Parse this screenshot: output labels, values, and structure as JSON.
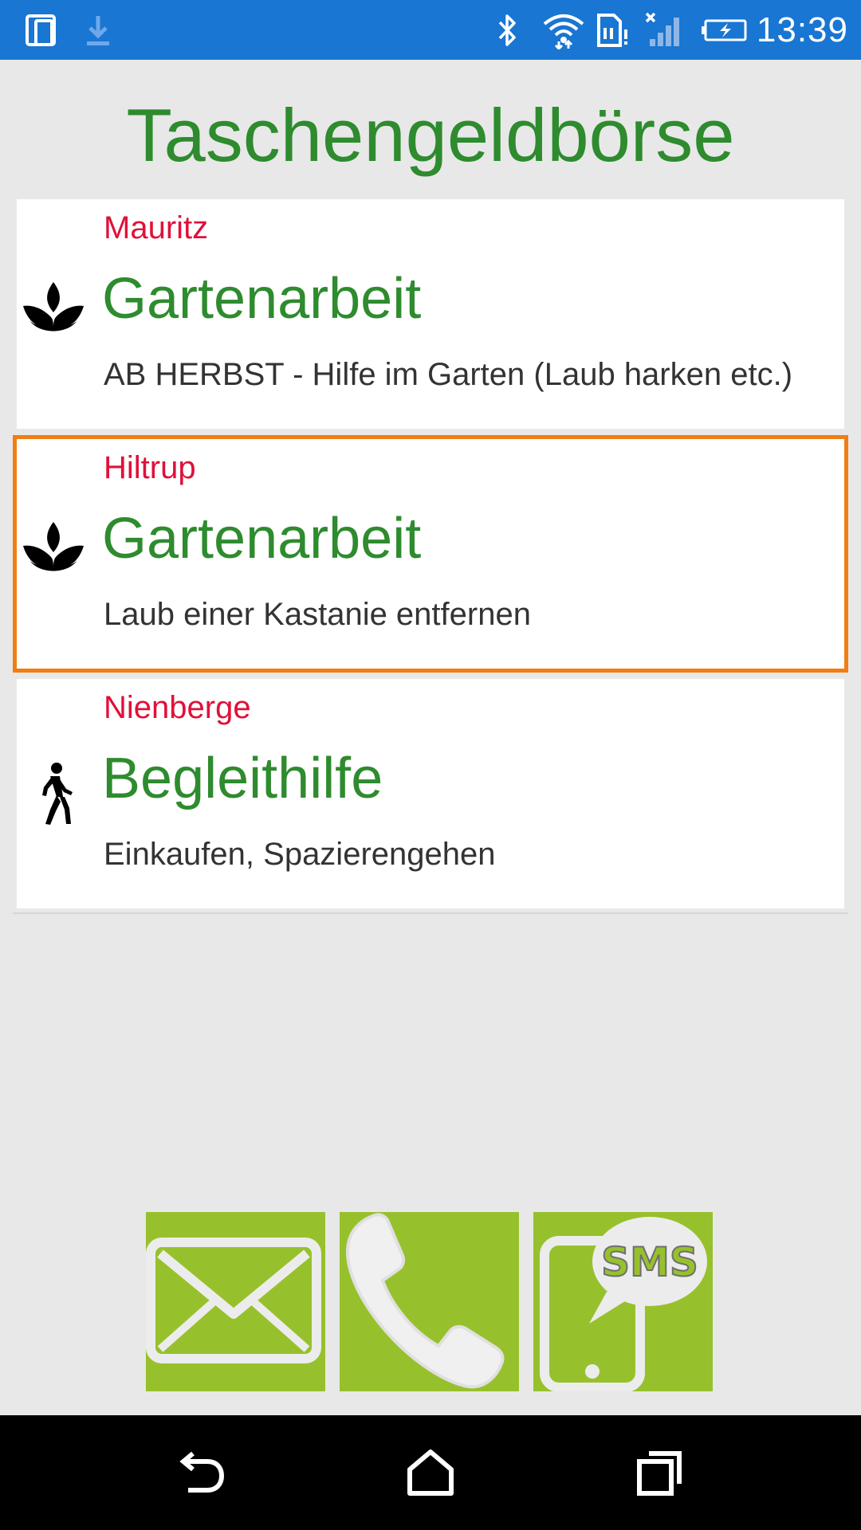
{
  "status_bar": {
    "time": "13:39",
    "icons": [
      "device-icon",
      "download-icon",
      "bluetooth-icon",
      "wifi-icon",
      "sim-icon",
      "signal-icon",
      "battery-icon"
    ],
    "color": "#1976d2"
  },
  "page": {
    "title": "Taschengeldbörse",
    "title_color": "#2e8b2e",
    "background": "#e8e8e8"
  },
  "jobs": [
    {
      "location": "Mauritz",
      "title": "Gartenarbeit",
      "description": "AB HERBST - Hilfe im Garten (Laub harken etc.)",
      "icon": "plant-icon",
      "selected": false
    },
    {
      "location": "Hiltrup",
      "title": "Gartenarbeit",
      "description": "Laub einer Kastanie entfernen",
      "icon": "plant-icon",
      "selected": true
    },
    {
      "location": "Nienberge",
      "title": "Begleithilfe",
      "description": "Einkaufen, Spazierengehen",
      "icon": "walking-person-icon",
      "selected": false
    }
  ],
  "colors": {
    "location": "#e0103a",
    "title": "#2e8b2e",
    "selection_border": "#f07e12",
    "contact_button": "#97c12c"
  },
  "contact_buttons": [
    {
      "name": "email-button",
      "icon": "envelope-icon"
    },
    {
      "name": "phone-button",
      "icon": "phone-icon"
    },
    {
      "name": "sms-button",
      "icon": "sms-icon",
      "label": "SMS"
    }
  ],
  "nav_bar": {
    "buttons": [
      "back-icon",
      "home-icon",
      "recents-icon"
    ]
  }
}
